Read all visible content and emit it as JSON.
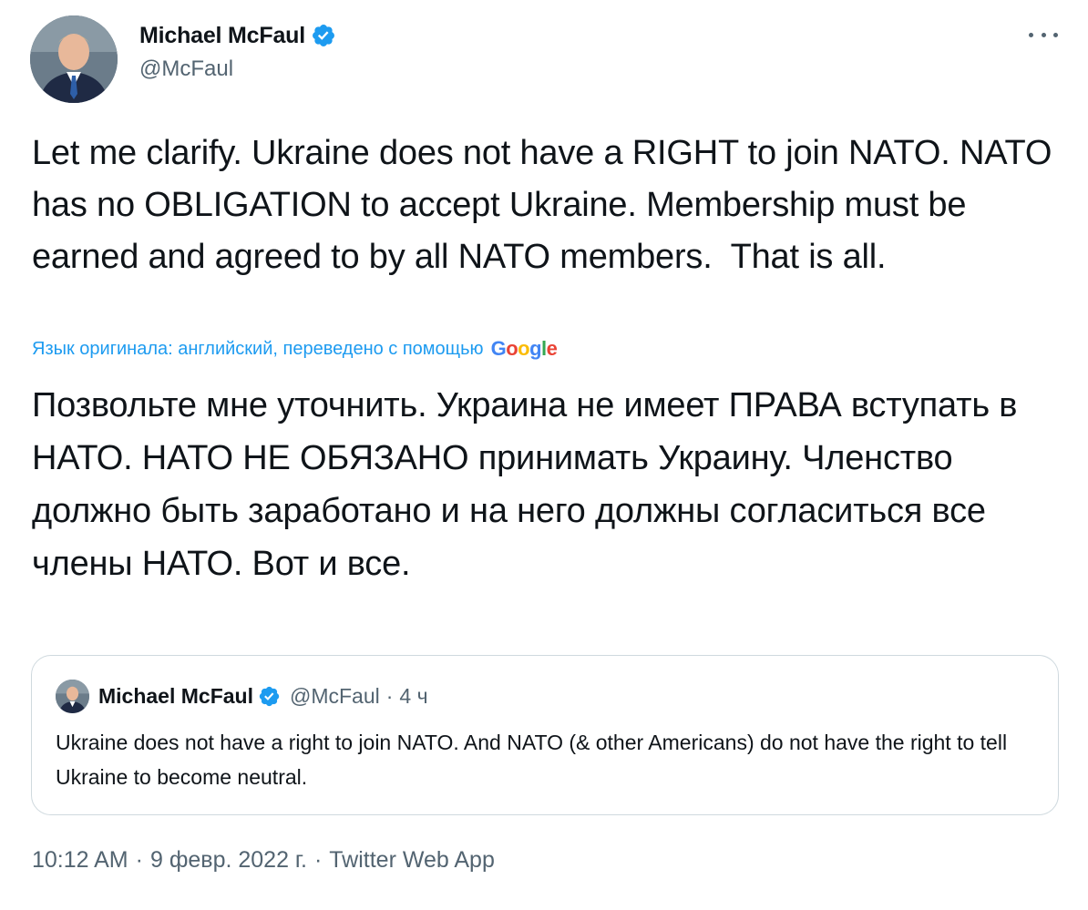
{
  "author": {
    "display_name": "Michael McFaul",
    "handle": "@McFaul",
    "verified": true,
    "avatar_icon": "profile-photo"
  },
  "tweet": {
    "text": "Let me clarify. Ukraine does not have a RIGHT to join NATO. NATO has no OBLIGATION to accept Ukraine. Membership must be earned and agreed to by all NATO members.  That is all.",
    "translation_note": "Язык оригинала: английский, переведено с помощью",
    "translation_provider": "Google",
    "translated_text": "Позвольте мне уточнить. Украина не имеет ПРАВА вступать в НАТО. НАТО НЕ ОБЯЗАНО принимать Украину. Членство должно быть заработано и на него должны согласиться все члены НАТО. Вот и все."
  },
  "quoted_tweet": {
    "display_name": "Michael McFaul",
    "handle": "@McFaul",
    "separator": "·",
    "time_ago": "4 ч",
    "text": "Ukraine does not have a right to join NATO. And NATO (& other Americans) do not have the right to tell Ukraine to become neutral."
  },
  "meta": {
    "time": "10:12 AM",
    "date": "9 февр. 2022 г.",
    "source": "Twitter Web App",
    "separator": "·"
  },
  "colors": {
    "accent": "#1d9bf0",
    "text_primary": "#0f1419",
    "text_secondary": "#536471",
    "border": "#cfd9de"
  }
}
